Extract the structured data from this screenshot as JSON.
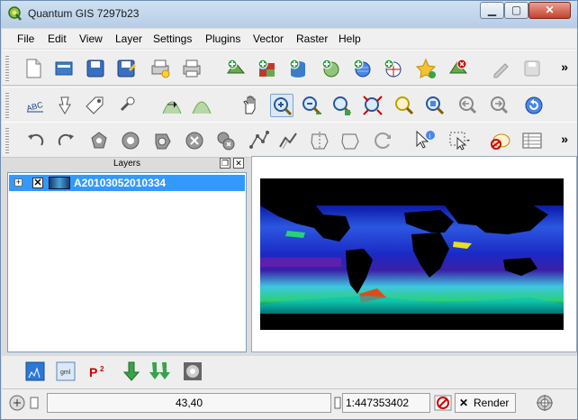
{
  "window": {
    "title": "Quantum GIS 7297b23"
  },
  "menubar": [
    {
      "label": "File"
    },
    {
      "label": "Edit"
    },
    {
      "label": "View"
    },
    {
      "label": "Layer"
    },
    {
      "label": "Settings"
    },
    {
      "label": "Plugins"
    },
    {
      "label": "Vector"
    },
    {
      "label": "Raster"
    },
    {
      "label": "Help"
    }
  ],
  "toolbar1": [
    "new-project-icon",
    "open-project-icon",
    "save-project-icon",
    "save-as-icon",
    "print-composer-icon",
    "print-icon",
    "add-vector-layer-icon",
    "add-raster-layer-icon",
    "add-postgis-layer-icon",
    "add-spatialite-layer-icon",
    "add-wms-layer-icon",
    "add-wfs-layer-icon",
    "new-shapefile-icon",
    "remove-layer-icon",
    "toggle-editing-icon",
    "save-edits-icon"
  ],
  "toolbar2": [
    "label-icon",
    "pin-icon",
    "tag-icon",
    "rotate-label-icon",
    "histogram-stretch-icon",
    "histogram-icon",
    "pan-icon",
    "zoom-in-icon",
    "zoom-out-icon",
    "zoom-full-icon",
    "zoom-layer-icon",
    "zoom-selection-icon",
    "zoom-native-icon",
    "zoom-last-icon",
    "zoom-next-icon",
    "refresh-icon"
  ],
  "toolbar3": [
    "undo-icon",
    "redo-icon",
    "add-ring-icon",
    "add-island-icon",
    "fill-ring-icon",
    "delete-ring-icon",
    "delete-part-icon",
    "reshape-icon",
    "offset-curve-icon",
    "split-icon",
    "merge-icon",
    "merge-attributes-icon",
    "rotate-icon",
    "identify-icon",
    "select-icon",
    "deselect-icon",
    "attribute-table-icon"
  ],
  "layers_panel": {
    "title": "Layers",
    "layers": [
      {
        "name": "A20103052010334",
        "checked": true
      }
    ]
  },
  "bottom_toolbar": [
    "raster-calculator-icon",
    "georeferencer-icon",
    "python-icon",
    "download-icon",
    "bulk-download-icon",
    "heatmap-icon"
  ],
  "statusbar": {
    "coordinate_value": "43,40",
    "scale_value": "1:447353402",
    "render_label": "Render"
  },
  "colors": {
    "selection": "#3399ff",
    "map_background": "#000000"
  }
}
